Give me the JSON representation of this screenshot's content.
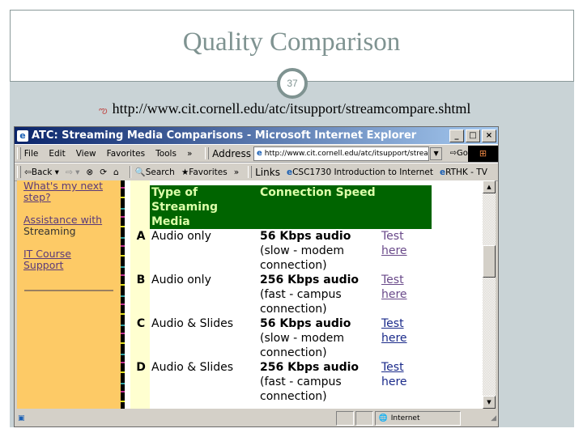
{
  "slide": {
    "title": "Quality Comparison",
    "page_number": "37",
    "bullet_icon": "curly-bullet-icon",
    "bullet_text": "http://www.cit.cornell.edu/atc/itsupport/streamcompare.shtml"
  },
  "browser": {
    "window_title": "ATC: Streaming Media Comparisons - Microsoft Internet Explorer",
    "window_buttons": {
      "minimize": "_",
      "maximize": "□",
      "close": "×"
    },
    "menu": [
      "File",
      "Edit",
      "View",
      "Favorites",
      "Tools",
      "»"
    ],
    "address_label": "Address",
    "address_value": "http://www.cit.cornell.edu/atc/itsupport/streamco",
    "go_label": "Go",
    "toolbar": {
      "back": "Back",
      "search": "Search",
      "favorites": "Favorites",
      "more": "»"
    },
    "links_label": "Links",
    "links": [
      "CSC1730 Introduction to Internet",
      "RTHK - TV"
    ],
    "status_zone": "Internet"
  },
  "page": {
    "left_nav": {
      "link1": "What's my next step?",
      "link2": "Assistance with",
      "link2_rest": "Streaming",
      "link3": "IT Course Support"
    },
    "table": {
      "headers": [
        "Type of Streaming Media",
        "Connection Speed",
        ""
      ],
      "rows": [
        {
          "letter": "A",
          "type": "Audio only",
          "speed": "56 Kbps audio",
          "detail": "(slow - modem connection)",
          "test1": "Test",
          "test2": "here"
        },
        {
          "letter": "B",
          "type": "Audio only",
          "speed": "256 Kbps audio",
          "detail": "(fast - campus connection)",
          "test1": "Test",
          "test2": "here"
        },
        {
          "letter": "C",
          "type": "Audio & Slides",
          "speed": "56 Kbps audio",
          "detail": "(slow - modem connection)",
          "test1": "Test",
          "test2": "here"
        },
        {
          "letter": "D",
          "type": "Audio & Slides",
          "speed": "256 Kbps audio",
          "detail": "(fast - campus connection)",
          "test1": "Test",
          "test2": "here"
        }
      ]
    }
  }
}
